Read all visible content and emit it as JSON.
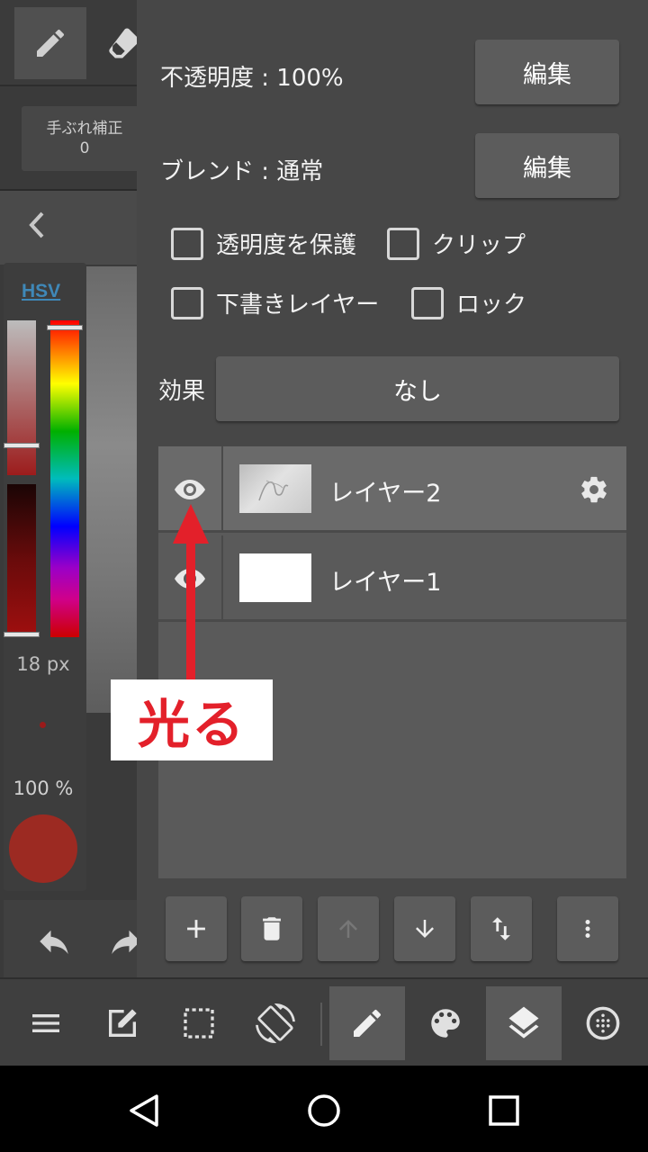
{
  "left_panel": {
    "stabilizer_label": "手ぶれ補正",
    "stabilizer_value": "0",
    "color_mode_label": "HSV",
    "brush_size": "18 px",
    "brush_opacity": "100 %",
    "current_color": "#9c2a22"
  },
  "layer_panel": {
    "opacity_label": "不透明度 : 100%",
    "blend_label": "ブレンド : 通常",
    "edit_label": "編集",
    "checkboxes": {
      "protect_alpha": "透明度を保護",
      "clip": "クリップ",
      "draft": "下書きレイヤー",
      "lock": "ロック"
    },
    "effect_label": "効果",
    "effect_value": "なし",
    "layers": [
      {
        "name": "レイヤー2",
        "selected": true
      },
      {
        "name": "レイヤー1",
        "selected": false
      }
    ]
  },
  "bottom_toolbar": {
    "items": [
      "menu-icon",
      "edit-icon",
      "selection-icon",
      "rotate-icon",
      "brush-icon",
      "palette-icon",
      "layers-icon",
      "material-icon"
    ],
    "active": [
      "brush-icon",
      "layers-icon"
    ]
  },
  "annotation": {
    "text": "光る",
    "color": "#e3202a"
  }
}
